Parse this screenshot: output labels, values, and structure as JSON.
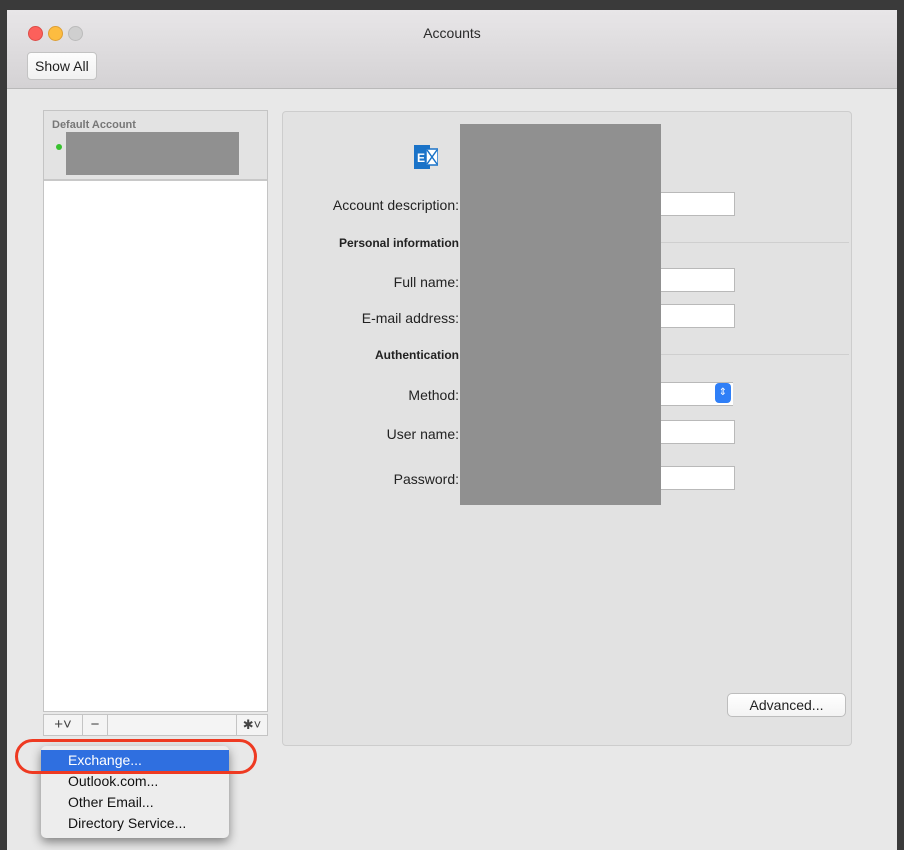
{
  "window": {
    "title": "Accounts",
    "show_all_label": "Show All"
  },
  "account_list": {
    "header_label": "Default Account",
    "status_color": "#38c22f",
    "toolbar": {
      "add_label": "+˅",
      "remove_label": "−",
      "gear_label": "✱˅"
    }
  },
  "detail": {
    "fields": {
      "account_description": "Account description:",
      "personal_information": "Personal information",
      "full_name": "Full name:",
      "email_address": "E-mail address:",
      "authentication": "Authentication",
      "method": "Method:",
      "user_name": "User name:",
      "password": "Password:"
    },
    "advanced_label": "Advanced..."
  },
  "add_menu": {
    "items": [
      "Exchange...",
      "Outlook.com...",
      "Other Email...",
      "Directory Service..."
    ],
    "selected_index": 0
  },
  "colors": {
    "accent": "#2f6fe0",
    "annotation": "#ee3a22",
    "exchange_blue": "#1a73c8"
  }
}
